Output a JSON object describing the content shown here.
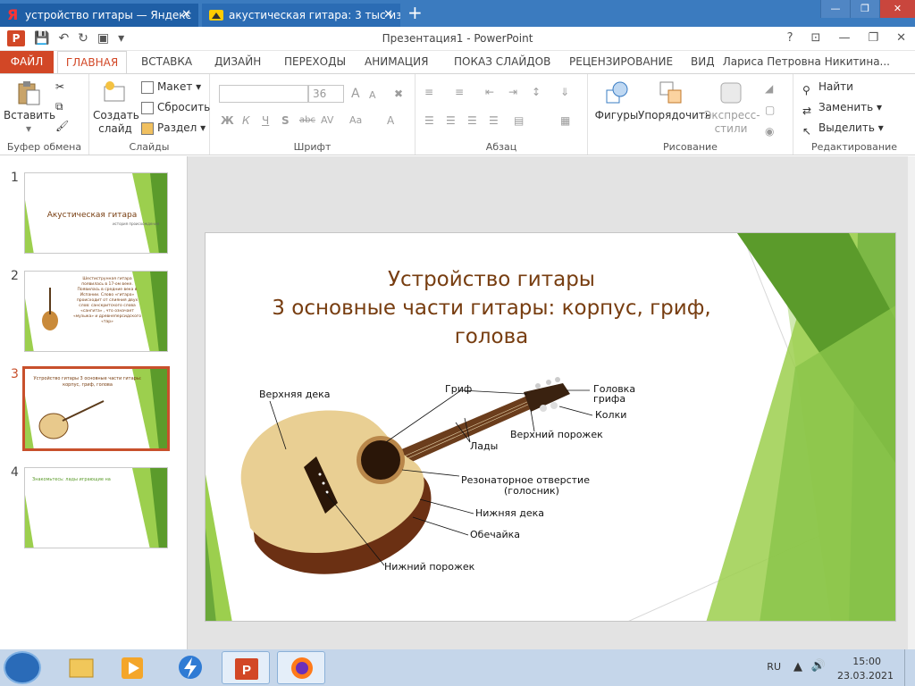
{
  "browser": {
    "tabs": [
      {
        "label": "устройство гитары — Яндекс"
      },
      {
        "label": "акустическая гитара: 3 тыс изо"
      }
    ],
    "new_tab": "+",
    "tab_close": "✕"
  },
  "window_controls": {
    "minimize": "—",
    "restore": "❐",
    "close": "✕"
  },
  "titlebar": {
    "app_icon_letter": "P",
    "title": "Презентация1 - PowerPoint",
    "help": "?",
    "ribbon_options": "⊡",
    "minimize": "—",
    "restore": "❐",
    "close": "✕"
  },
  "ribbon_tabs": {
    "file": "ФАЙЛ",
    "home": "ГЛАВНАЯ",
    "items": [
      "ВСТАВКА",
      "ДИЗАЙН",
      "ПЕРЕХОДЫ",
      "АНИМАЦИЯ",
      "ПОКАЗ СЛАЙДОВ",
      "РЕЦЕНЗИРОВАНИЕ",
      "ВИД"
    ],
    "user": "Лариса Петровна Никитина..."
  },
  "ribbon": {
    "clipboard": {
      "paste": "Вставить",
      "label": "Буфер обмена"
    },
    "slides": {
      "new_slide": "Создать слайд",
      "layout": "Макет",
      "reset": "Сбросить",
      "section": "Раздел",
      "label": "Слайды"
    },
    "font": {
      "size": "36",
      "bold": "Ж",
      "italic": "К",
      "underline": "Ч",
      "shadow": "S",
      "strike": "abc",
      "spacing": "AV",
      "case": "Aa",
      "color": "A",
      "grow": "A",
      "shrink": "A",
      "label": "Шрифт"
    },
    "paragraph": {
      "label": "Абзац"
    },
    "drawing": {
      "shapes": "Фигуры",
      "arrange": "Упорядочить",
      "quick_styles": "Экспресс-стили",
      "label": "Рисование"
    },
    "editing": {
      "find": "Найти",
      "replace": "Заменить",
      "select": "Выделить",
      "label": "Редактирование"
    }
  },
  "thumbnails": [
    {
      "num": "1",
      "title": "Акустическая гитара",
      "subtitle": "история происхождения"
    },
    {
      "num": "2",
      "text": "Шестиструнная гитара появилась в 17-ом веке. Появилась в средние века в Испании. Слово «гитара» происходит от слияния двух слов: санскритского слова «сангита» , что означает «музыка» и древнеперсидского «тар»"
    },
    {
      "num": "3",
      "text": "Устройство гитары 3 основные части гитары: корпус, гриф, голова"
    },
    {
      "num": "4",
      "text": "Знакомьтесь: лады играющие на"
    }
  ],
  "slide": {
    "title_line1": "Устройство гитары",
    "title_line2": "3 основные части гитары: корпус, гриф,",
    "title_line3": "голова",
    "labels": {
      "top_deck": "Верхняя дека",
      "neck": "Гриф",
      "headstock_1": "Головка",
      "headstock_2": "грифа",
      "pegs": "Колки",
      "nut": "Верхний порожек",
      "frets": "Лады",
      "soundhole_1": "Резонаторное отверстие",
      "soundhole_2": "(голосник)",
      "back": "Нижняя дека",
      "sides": "Обечайка",
      "saddle": "Нижний порожек"
    }
  },
  "taskbar": {
    "lang": "RU",
    "time": "15:00",
    "date": "23.03.2021"
  },
  "colors": {
    "accent": "#d24726",
    "title_text": "#773d10",
    "green_dark": "#5b9b2b",
    "green_light": "#9ccf4e",
    "browser_tab": "#3b7bbf"
  }
}
